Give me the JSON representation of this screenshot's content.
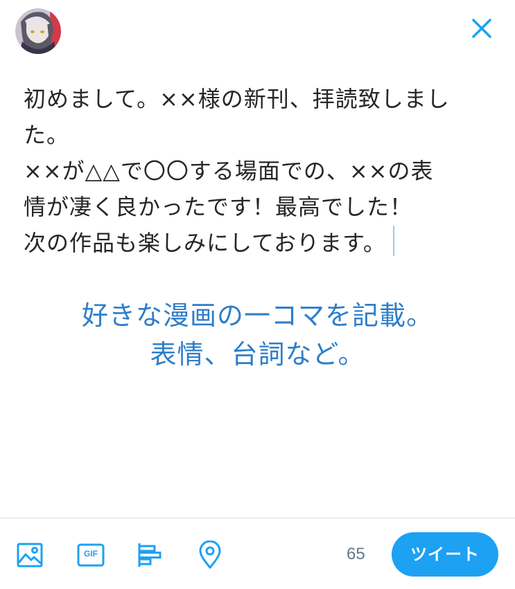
{
  "header": {
    "avatar_icon": "user-avatar",
    "close_icon": "close-icon"
  },
  "compose": {
    "lines": [
      "初めまして。××様の新刊、拝読致しまし",
      "た。",
      "××が△△で〇〇する場面での、××の表",
      "情が凄く良かったです！最高でした！",
      "次の作品も楽しみにしております。"
    ]
  },
  "annotation": {
    "line1": "好きな漫画の一コマを記載。",
    "line2": "表情、台詞など。"
  },
  "toolbar": {
    "icons": [
      "image-icon",
      "gif-icon",
      "poll-icon",
      "location-icon"
    ],
    "gif_label": "GIF",
    "char_count": "65",
    "tweet_label": "ツイート"
  },
  "colors": {
    "accent": "#1da1f2",
    "annotation": "#2f7ec9",
    "text": "#262626",
    "muted": "#657786"
  }
}
